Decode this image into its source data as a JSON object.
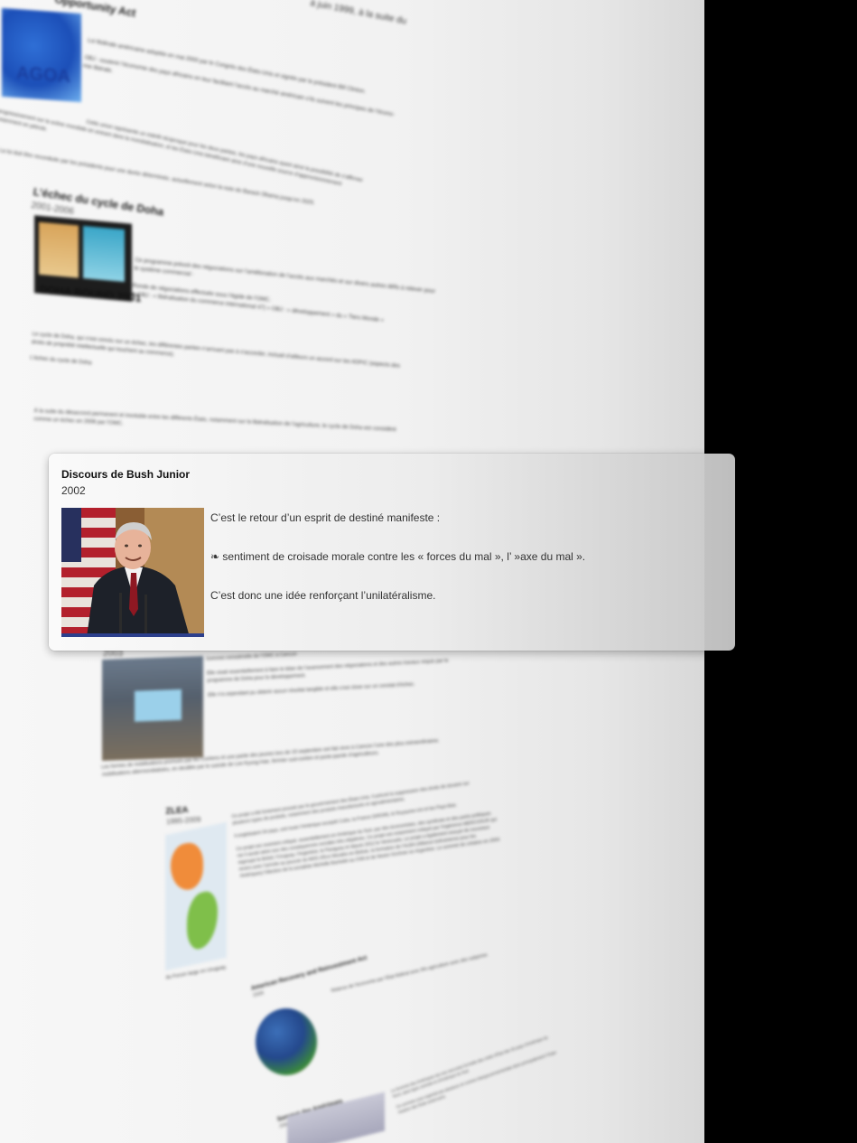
{
  "popup": {
    "title": "Discours de Bush Junior",
    "year": "2002",
    "paragraphs": [
      "C’est le retour d’un esprit de destiné manifeste :",
      "❧ sentiment de croisade morale contre les « forces du mal », l’ »axe du mal ».",
      "C’est donc une idée renforçant l’unilatéralisme."
    ]
  },
  "background": {
    "agoa": {
      "header": "Opportunity Act",
      "top_right": "à juin 1999, à la suite du",
      "logo_text": "AGOA",
      "lines": [
        "Loi fédérale américaine adoptée en mai 2000 par le Congrès des États-Unis et signée par le président Bill Clinton.",
        "OBJ : soutenir l’économie des pays africains en leur facilitant l’accès au marché américain s’ils suivent les principes de l’écono-",
        "mie libérale.",
        "Cette union représente un intérêt réciproque pour les deux parties, les pays africains ayant ainsi la possibilité de s’affirmer",
        "progressivement sur la scène mondiale en entrant dans la mondialisation, et les États-Unis bénéficiant ainsi d’une nouvelle source d’approvisionnement",
        "notamment en pétrole.",
        "La loi doit être reconduite par les présidents pour une durée déterminée, actuellement selon la note de Barack Obama jusqu’en 2025."
      ]
    },
    "doha": {
      "title": "L’échec du cycle de Doha",
      "years": "2001-2006",
      "caption": "DOHA ROUND 2001",
      "lines": [
        "Ce programme prévoit des négociations sur l’amélioration de l’accès aux marchés et sur divers autres défis à relever pour",
        "le système commercial :",
        "Ronde de négociations effectuée sous l’égide de l’OMC.",
        "❧ OBJ : « libéralisation du commerce international 47) » OBJ : « développement » du « Tiers Monde »",
        "Le cycle de Doha, qui s’est conclu sur un échec, les différentes parties n’arrivant pas à s’accorder, incluait d’ailleurs un accord sur les ADPIC (aspects des",
        "droits de propriété intellectuelle qui touchent au commerce).",
        "L’échec du cycle de Doha",
        "À la suite du désaccord permanent et insoluble entre les différents États, notamment sur la libéralisation de l’agriculture, le cycle de Doha est considéré",
        "comme un échec en 2006 par l’OMC."
      ]
    },
    "cancun": {
      "years": "2003",
      "sign": "OUR CLIMATE NOT YOUR BUSINESS",
      "lines": [
        "Sommet ministérielle de l’OMC à Cancun",
        "Elle visait essentiellement à faire le bilan de l’avancement des négociations et des autres travaux requis par le",
        "programme de Doha pour le développement.",
        "Elle n’a cependant pu obtenir aucun résultat tangible et elle s’est close sur un constat d’échec.",
        "Les formes de mobilisations promues par les Coréens et une partie des jeunes lors de 10 septembre ont fait vivre à Cancún l’une des plus extraordinaires",
        "mobilisations altermondialistes, en deuillée par le suicide de Lee Kyung-Hae, fermier sud-coréen et porte-parole d’agriculteurs."
      ]
    },
    "zlea": {
      "title": "ZLEA",
      "years": "1995-2009",
      "lines": [
        "Ce projet a été fortement poussé par le gouvernement des États-Unis. Il prévoit la suppression des droits de douane sur",
        "plusieurs types de produits, notamment des produits manufacturés et agroalimentaires.",
        "Il englobaient 34 pays, soit toute l’Amérique excepté Cuba, la France (DROM), le Royaume-Uni et les Pays-Bas.",
        "Ce projet est vivement critiqué, essentiellement en Amérique du Sud, par des économistes, des syndicats et des partis politiques",
        "car il aurait selon eux des conséquences sociales très négatives. Ce projet est notamment critiqué par l’ingérence MERCOSUR qui",
        "regroupe le Brésil, l’Uruguay, l’Argentine, le Paraguay et depuis 2012 le Venezuela. Le projet a également essuyé de nouveaux",
        "revers avec l’arrivée au pouvoir du MAS d’Evo Morales en Bolivie, la formation de l’ALBA (Alliance bolivarienne pour les",
        "Amériques) l’élection de la socialiste Michelle Bachelet au Chili et de Nestor Kirchner en Argentine. Le sommet de création en 2004",
        "du Forum large en Uruguay."
      ]
    },
    "recovery": {
      "title": "American Recovery and Reinvestment Act",
      "years": "2009",
      "lines": [
        "Relance de l’économie par l’État fédéral avec 9% agriculture avec des subprime."
      ]
    },
    "summit": {
      "title": "Sommet des Amériques",
      "years": "2009",
      "lines": [
        "Le Sommet des Amériques est une rencontre formelle des chefs d’État des 35 pays d’Amérique du",
        "Nord, dans ligne centrale et d’Amérique du Sud.",
        "Ce sommet s’est organisé par plusieurs et comme intergouvernementale dans principalement l’Orga-",
        "nisation des États américains."
      ]
    }
  },
  "colors": {
    "page_background": "#f2f2f2",
    "outer_background": "#000000",
    "popup_background": "#f5f5f5",
    "title_text": "#111111",
    "body_text": "#333333"
  }
}
